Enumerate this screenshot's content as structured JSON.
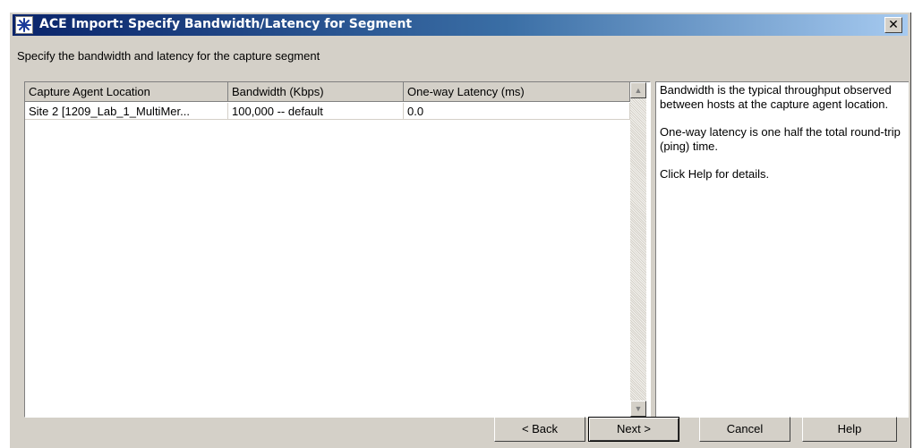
{
  "window": {
    "title": "ACE Import: Specify Bandwidth/Latency for Segment",
    "close_label": "✕",
    "app_icon": "ace-star-icon"
  },
  "instruction": "Specify the bandwidth and latency for the capture segment",
  "table": {
    "columns": [
      "Capture Agent Location",
      "Bandwidth (Kbps)",
      "One-way Latency (ms)"
    ],
    "rows": [
      [
        "Site 2 [1209_Lab_1_MultiMer...",
        "100,000 -- default",
        "0.0"
      ]
    ]
  },
  "help_panel": {
    "paragraphs": [
      "Bandwidth is the typical throughput observed between hosts at the capture agent location.",
      "One-way latency is one half the total round-trip (ping) time.",
      "Click Help for details."
    ]
  },
  "buttons": {
    "back": "< Back",
    "next": "Next >",
    "cancel": "Cancel",
    "help": "Help"
  }
}
